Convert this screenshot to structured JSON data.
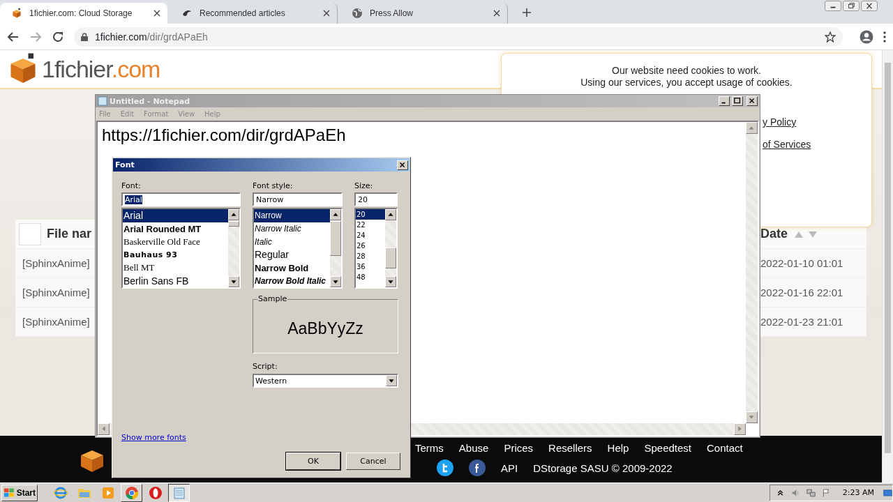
{
  "browser": {
    "tabs": [
      {
        "title": "1fichier.com: Cloud Storage",
        "kind": "cube",
        "selected": true
      },
      {
        "title": "Recommended articles",
        "kind": "swirl",
        "selected": false
      },
      {
        "title": "Press Allow",
        "kind": "globe",
        "selected": false
      }
    ],
    "url_domain": "1fichier.com",
    "url_path": "/dir/grdAPaEh"
  },
  "site": {
    "logo_name": "1fichier",
    "logo_suffix": ".com",
    "table": {
      "checked": false,
      "columns": [
        "File nar",
        "Date"
      ],
      "rows": [
        {
          "name": "[SphinxAnime]",
          "date": "2022-01-10 01:01"
        },
        {
          "name": "[SphinxAnime]",
          "date": "2022-01-16 22:01"
        },
        {
          "name": "[SphinxAnime]",
          "date": "2022-01-23 21:01"
        }
      ]
    },
    "footer": {
      "links": [
        "Terms",
        "Abuse",
        "Prices",
        "Resellers",
        "Help",
        "Speedtest",
        "Contact"
      ],
      "api": "API",
      "copyright": "DStorage SASU © 2009-2022"
    }
  },
  "cookie_notice": {
    "lines": [
      "Our website need cookies to work.",
      "Using our services, you accept usage of cookies."
    ],
    "links": [
      "y Policy",
      "of Services"
    ]
  },
  "notepad": {
    "title": "Untitled - Notepad",
    "menu": [
      "File",
      "Edit",
      "Format",
      "View",
      "Help"
    ],
    "text": "https://1fichier.com/dir/grdAPaEh"
  },
  "font_dialog": {
    "title": "Font",
    "font": {
      "label": "Font:",
      "value": "Arial",
      "items": [
        {
          "text": "Arial",
          "kind": "sans",
          "selected": true
        },
        {
          "text": "Arial Rounded MT",
          "kind": "bold",
          "selected": false
        },
        {
          "text": "Baskerville Old Face",
          "kind": "serif",
          "selected": false
        },
        {
          "text": "Bauhaus 93",
          "kind": "heavy",
          "selected": false
        },
        {
          "text": "Bell MT",
          "kind": "serif",
          "selected": false
        },
        {
          "text": "Berlin Sans FB",
          "kind": "sans",
          "selected": false
        }
      ]
    },
    "style": {
      "label": "Font style:",
      "value": "Narrow",
      "items": [
        {
          "text": "Narrow",
          "kind": "narrow",
          "selected": true
        },
        {
          "text": "Narrow Italic",
          "kind": "italic",
          "selected": false
        },
        {
          "text": "Italic",
          "kind": "italic",
          "selected": false
        },
        {
          "text": "Regular",
          "kind": "sans",
          "selected": false
        },
        {
          "text": "Narrow Bold",
          "kind": "bold",
          "selected": false
        },
        {
          "text": "Narrow Bold Italic",
          "kind": "bolditalic",
          "selected": false
        }
      ]
    },
    "size": {
      "label": "Size:",
      "value": "20",
      "items": [
        {
          "text": "20",
          "kind": "plain",
          "selected": true
        },
        {
          "text": "22",
          "kind": "plain",
          "selected": false
        },
        {
          "text": "24",
          "kind": "plain",
          "selected": false
        },
        {
          "text": "26",
          "kind": "plain",
          "selected": false
        },
        {
          "text": "28",
          "kind": "plain",
          "selected": false
        },
        {
          "text": "36",
          "kind": "plain",
          "selected": false
        },
        {
          "text": "48",
          "kind": "plain",
          "selected": false
        }
      ]
    },
    "sample_label": "Sample",
    "sample": "AaBbYyZz",
    "script_label": "Script:",
    "script": "Western",
    "more_link": "Show more fonts",
    "buttons": [
      "OK",
      "Cancel"
    ]
  },
  "taskbar": {
    "start": "Start",
    "apps": [
      {
        "kind": "ie",
        "running": false,
        "selected": false
      },
      {
        "kind": "folder",
        "running": false,
        "selected": false
      },
      {
        "kind": "media",
        "running": false,
        "selected": false
      },
      {
        "kind": "chrome",
        "running": true,
        "selected": false
      },
      {
        "kind": "opera",
        "running": false,
        "selected": false
      },
      {
        "kind": "notepad",
        "running": true,
        "selected": true
      }
    ],
    "time": "2:23 AM"
  }
}
